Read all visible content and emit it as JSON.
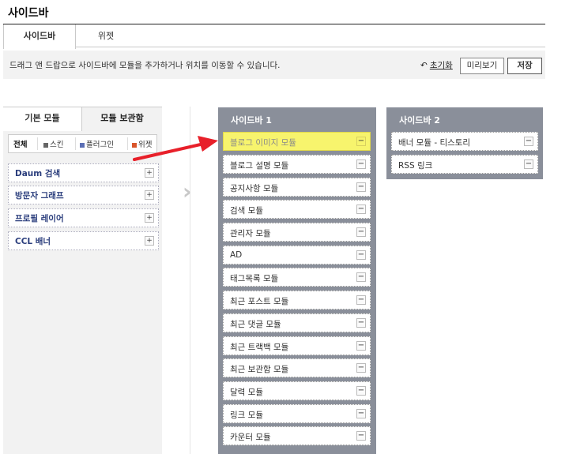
{
  "page": {
    "title": "사이드바"
  },
  "tabs": [
    {
      "label": "사이드바"
    },
    {
      "label": "위젯"
    }
  ],
  "infobar": {
    "text": "드래그 앤 드랍으로 사이드바에 모듈을 추가하거나 위치를 이동할 수 있습니다.",
    "reset_label": "초기화",
    "preview_label": "미리보기",
    "save_label": "저장"
  },
  "left_panel": {
    "tabs": [
      {
        "label": "기본 모듈"
      },
      {
        "label": "모듈 보관함"
      }
    ],
    "filters": [
      {
        "label": "전체"
      },
      {
        "label": "스킨",
        "color": "#666666"
      },
      {
        "label": "플러그인",
        "color": "#5b6fb5"
      },
      {
        "label": "위젯",
        "color": "#d9552b"
      }
    ],
    "items": [
      {
        "label": "Daum 검색"
      },
      {
        "label": "방문자 그래프"
      },
      {
        "label": "프로필 레이어"
      },
      {
        "label": "CCL 배너"
      }
    ]
  },
  "sidebar1": {
    "title": "사이드바 1",
    "items": [
      {
        "label": "블로그 이미지 모듈"
      },
      {
        "label": "블로그 설명 모듈"
      },
      {
        "label": "공지사항 모듈"
      },
      {
        "label": "검색 모듈"
      },
      {
        "label": "관리자 모듈"
      },
      {
        "label": "AD"
      },
      {
        "label": "태그목록 모듈"
      },
      {
        "label": "최근 포스트 모듈"
      },
      {
        "label": "최근 댓글 모듈"
      },
      {
        "label": "최근 트랙백 모듈"
      },
      {
        "label": "최근 보관함 모듈"
      },
      {
        "label": "달력 모듈"
      },
      {
        "label": "링크 모듈"
      },
      {
        "label": "카운터 모듈"
      }
    ]
  },
  "sidebar2": {
    "title": "사이드바 2",
    "items": [
      {
        "label": "배너 모듈 - 티스토리"
      },
      {
        "label": "RSS 링크"
      }
    ]
  },
  "colors": {
    "highlight": "#f7f46d",
    "arrow": "#e8202a",
    "sidebar_bg": "#8a8f9a"
  }
}
